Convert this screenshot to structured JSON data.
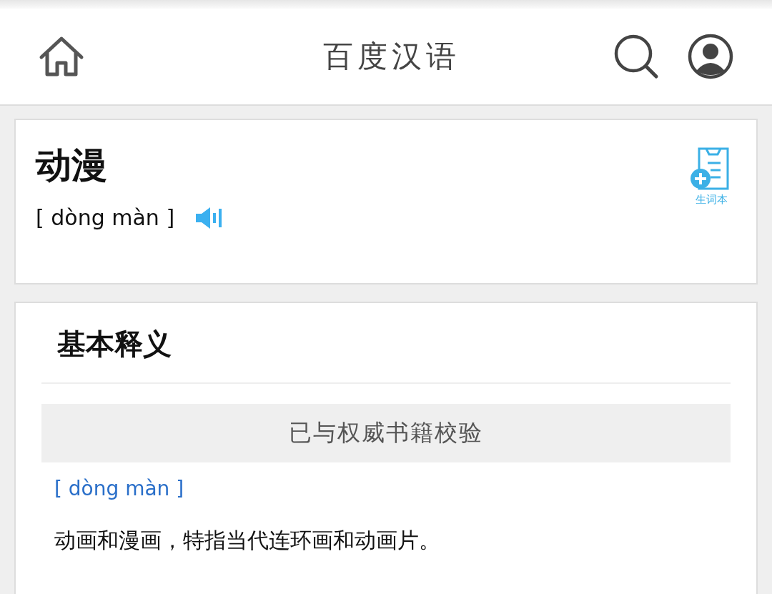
{
  "header": {
    "title": "百度汉语"
  },
  "word": {
    "text": "动漫",
    "pinyin": "[ dòng màn ]",
    "wordbook_label": "生词本"
  },
  "definition": {
    "heading": "基本释义",
    "verified_note": "已与权威书籍校验",
    "pinyin": "[ dòng màn ]",
    "meaning": "动画和漫画，特指当代连环画和动画片。"
  }
}
